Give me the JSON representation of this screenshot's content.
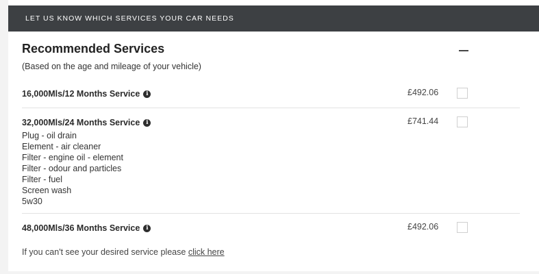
{
  "header": {
    "title": "LET US KNOW WHICH SERVICES YOUR CAR NEEDS"
  },
  "section": {
    "title": "Recommended Services",
    "subtitle": "(Based on the age and mileage of your vehicle)",
    "collapse_icon": "minus-icon"
  },
  "services": [
    {
      "name": "16,000Mls/12 Months Service",
      "price": "£492.06",
      "checked": false,
      "components": []
    },
    {
      "name": "32,000Mls/24 Months Service",
      "price": "£741.44",
      "checked": false,
      "components": [
        "Plug - oil drain",
        "Element - air cleaner",
        "Filter - engine oil - element",
        "Filter - odour and particles",
        "Filter - fuel",
        "Screen wash",
        "5w30"
      ]
    },
    {
      "name": "48,000Mls/36 Months Service",
      "price": "£492.06",
      "checked": false,
      "components": []
    }
  ],
  "footer": {
    "note": "If you can't see your desired service please",
    "link": "click here"
  },
  "colors": {
    "header_bg": "#3d4043",
    "page_bg": "#f3f3f3",
    "panel_bg": "#ffffff"
  }
}
